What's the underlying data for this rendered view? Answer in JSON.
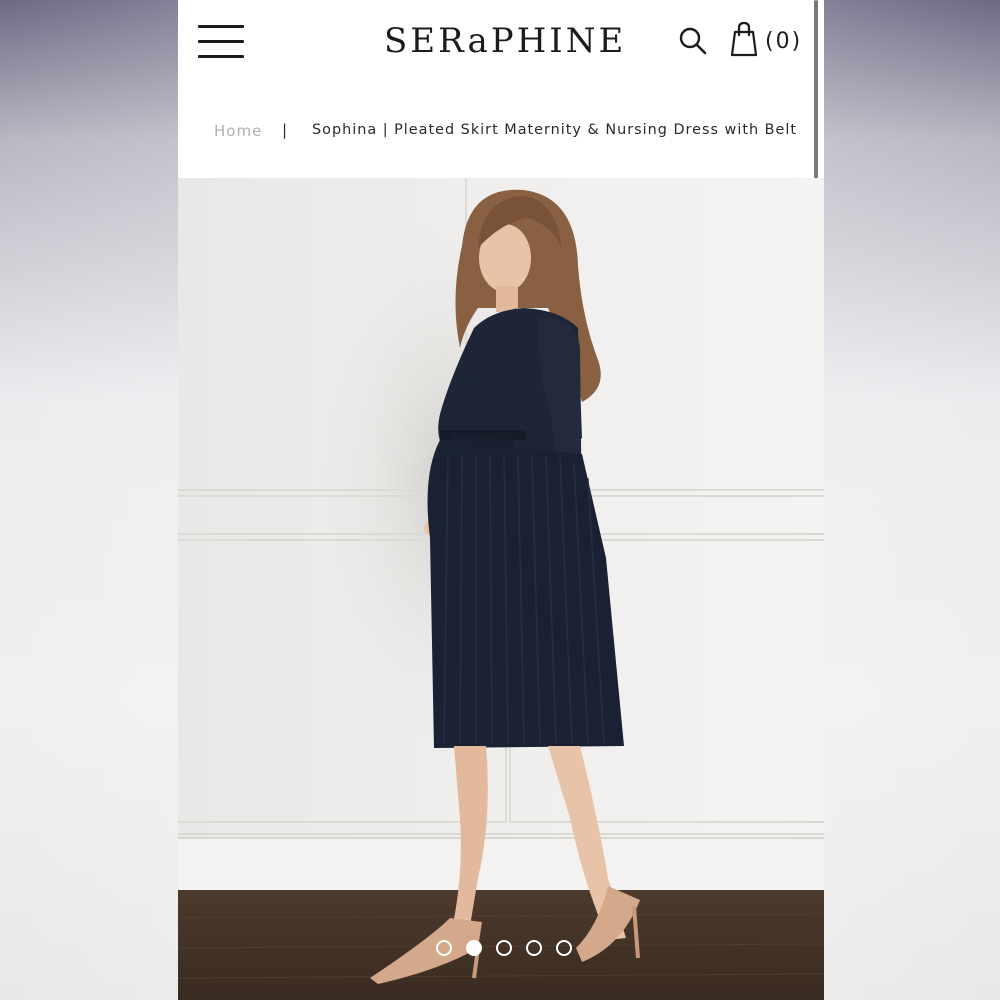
{
  "header": {
    "logo_text": "SERaPHINE",
    "cart_count": "(0)",
    "icons": [
      "menu-icon",
      "search-icon",
      "shopping-bag-icon"
    ]
  },
  "breadcrumb": {
    "home": "Home",
    "separator": "|",
    "current": "Sophina | Pleated Skirt Maternity & Nursing Dress with Belt"
  },
  "carousel": {
    "slide_count": 5,
    "active_index": 1
  },
  "colors": {
    "text": "#1c1c1c",
    "muted": "#b1b1b1",
    "dress": "#1e2536",
    "shoes": "#d4a88a"
  }
}
